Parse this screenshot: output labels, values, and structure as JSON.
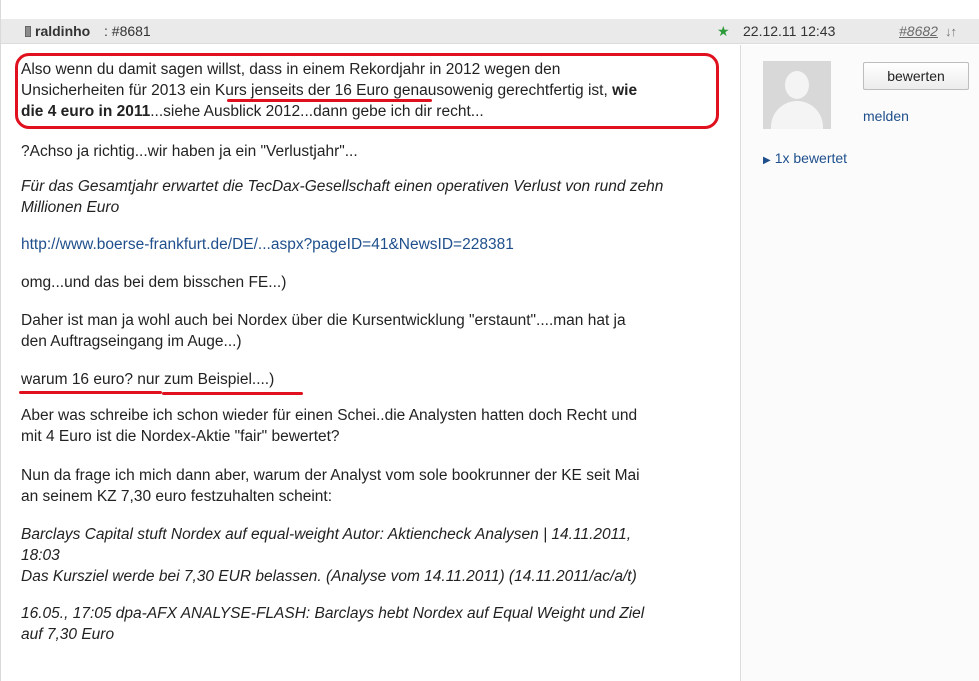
{
  "header": {
    "author": "raldinho",
    "post_number": ": #8681",
    "timestamp": "22.12.11 12:43",
    "next_post": "#8682",
    "star_icon": "★",
    "sort_icon": "↓↑"
  },
  "sidebar": {
    "rate_button": "bewerten",
    "report_link": "melden",
    "rated": "1x bewertet"
  },
  "post": {
    "quote_a": "Also wenn du damit sagen willst, dass in einem Rekordjahr in 2012 wegen den",
    "quote_b1": "Unsicherheiten für 2013 ein ",
    "quote_b2": "Kurs jenseits der 16 Euro",
    "quote_b3": " genausowenig gerechtfertig ist, ",
    "quote_b4": "wie",
    "quote_c1": "die 4 euro in 2011",
    "quote_c2": "...siehe Ausblick 2012...dann gebe ich dir recht...",
    "p2": "?Achso ja richtig...wir haben ja ein \"Verlustjahr\"...",
    "p3a": "Für das Gesamtjahr erwartet die TecDax-Gesellschaft einen operativen Verlust von rund zehn",
    "p3b": "Millionen Euro",
    "p4": "http://www.boerse-frankfurt.de/DE/...aspx?pageID=41&NewsID=228381",
    "p5": "omg...und das bei dem bisschen FE...)",
    "p6a": "Daher ist man ja wohl auch bei Nordex  über die Kursentwicklung \"erstaunt\"....man hat ja",
    "p6b": "den Auftragseingang im Auge...)",
    "p7": "warum 16 euro? nur zum Beispiel....)",
    "p8a": "Aber was schreibe ich schon wieder für einen Schei..die Analysten hatten doch Recht und",
    "p8b": "mit 4 Euro ist die Nordex-Aktie \"fair\" bewertet?",
    "p9a": "Nun da frage  ich mich dann aber, warum der Analyst vom sole bookrunner der KE seit Mai",
    "p9b": "an seinem KZ 7,30 euro festzuhalten scheint:",
    "p10a": "Barclays Capital stuft Nordex auf equal-weight Autor: Aktiencheck Analysen  |  14.11.2011,",
    "p10b": "18:03",
    "p10c": "Das Kursziel werde bei 7,30 EUR belassen. (Analyse vom 14.11.2011) (14.11.2011/ac/a/t)",
    "p11a": "16.05., 17:05 dpa-AFX ANALYSE-FLASH: Barclays hebt Nordex auf Equal Weight und Ziel",
    "p11b": "auf 7,30 Euro"
  },
  "colors": {
    "annotation": "#e0101e",
    "link": "#1e4f8c",
    "header_bg": "#eaeaea",
    "star": "#2e9b3b"
  }
}
